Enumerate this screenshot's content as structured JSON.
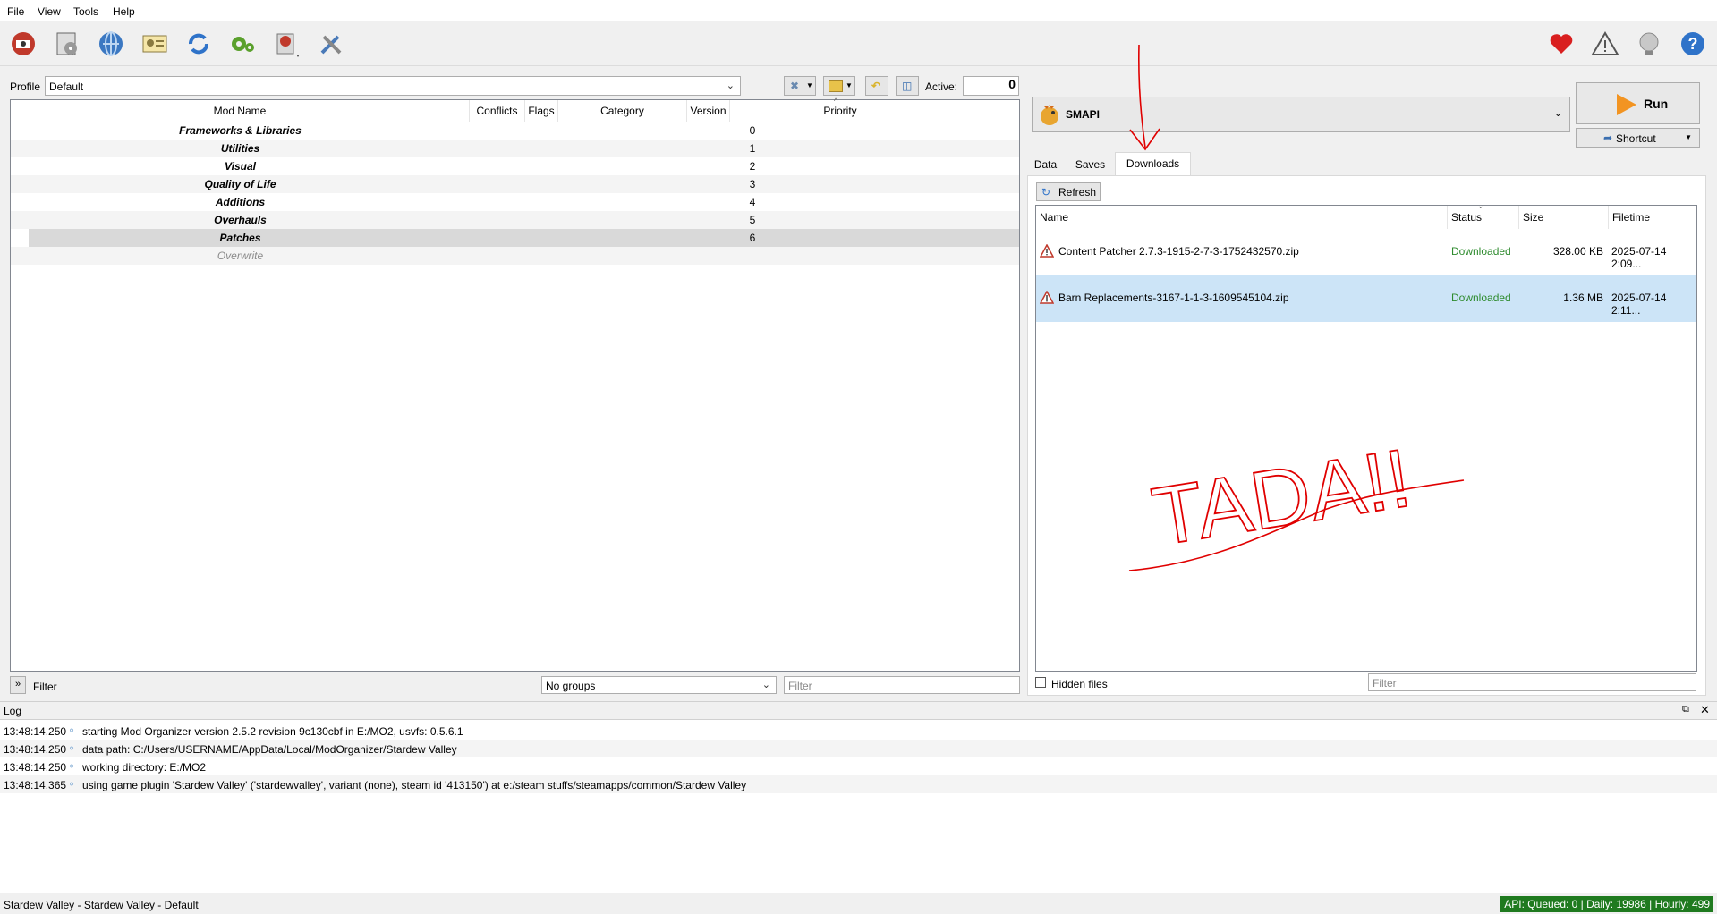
{
  "menu": [
    "File",
    "View",
    "Tools",
    "Help"
  ],
  "profile": {
    "label": "Profile",
    "value": "Default",
    "active_label": "Active:",
    "active_value": "0"
  },
  "modlist": {
    "headers": [
      "Mod Name",
      "Conflicts",
      "Flags",
      "Category",
      "Version",
      "Priority"
    ],
    "rows": [
      {
        "name": "Frameworks & Libraries",
        "priority": "0"
      },
      {
        "name": "Utilities",
        "priority": "1"
      },
      {
        "name": "Visual",
        "priority": "2"
      },
      {
        "name": "Quality of Life",
        "priority": "3"
      },
      {
        "name": "Additions",
        "priority": "4"
      },
      {
        "name": "Overhauls",
        "priority": "5"
      },
      {
        "name": "Patches",
        "priority": "6"
      },
      {
        "name": "Overwrite",
        "priority": ""
      }
    ],
    "filter_label": "Filter",
    "groups_value": "No groups",
    "filter_placeholder": "Filter"
  },
  "executable": {
    "value": "SMAPI",
    "run_label": "Run",
    "shortcut_label": "Shortcut"
  },
  "tabs": [
    "Data",
    "Saves",
    "Downloads"
  ],
  "downloads": {
    "refresh_label": "Refresh",
    "headers": [
      "Name",
      "Status",
      "Size",
      "Filetime"
    ],
    "rows": [
      {
        "name": "Content Patcher 2.7.3-1915-2-7-3-1752432570.zip",
        "status": "Downloaded",
        "size": "328.00 KB",
        "filetime": "2025-07-14 2:09..."
      },
      {
        "name": "Barn Replacements-3167-1-1-3-1609545104.zip",
        "status": "Downloaded",
        "size": "1.36 MB",
        "filetime": "2025-07-14 2:11..."
      }
    ],
    "hidden_files_label": "Hidden files",
    "filter_placeholder": "Filter",
    "annotation": "TADA!!"
  },
  "log": {
    "title": "Log",
    "rows": [
      {
        "time": "13:48:14.250",
        "msg": "starting Mod Organizer version 2.5.2 revision 9c130cbf in E:/MO2, usvfs: 0.5.6.1"
      },
      {
        "time": "13:48:14.250",
        "msg": "data path: C:/Users/USERNAME/AppData/Local/ModOrganizer/Stardew Valley"
      },
      {
        "time": "13:48:14.250",
        "msg": "working directory: E:/MO2"
      },
      {
        "time": "13:48:14.365",
        "msg": "using game plugin 'Stardew Valley' ('stardewvalley', variant (none), steam id '413150') at e:/steam stuffs/steamapps/common/Stardew Valley"
      }
    ]
  },
  "status": {
    "left": "Stardew Valley - Stardew Valley - Default",
    "api": "API: Queued: 0 | Daily: 19986 | Hourly: 499"
  },
  "colors": {
    "downloaded": "#2e8b2e",
    "selected_row": "#cce4f7",
    "annotation": "#e00000",
    "api_bg": "#1f7a1f"
  }
}
